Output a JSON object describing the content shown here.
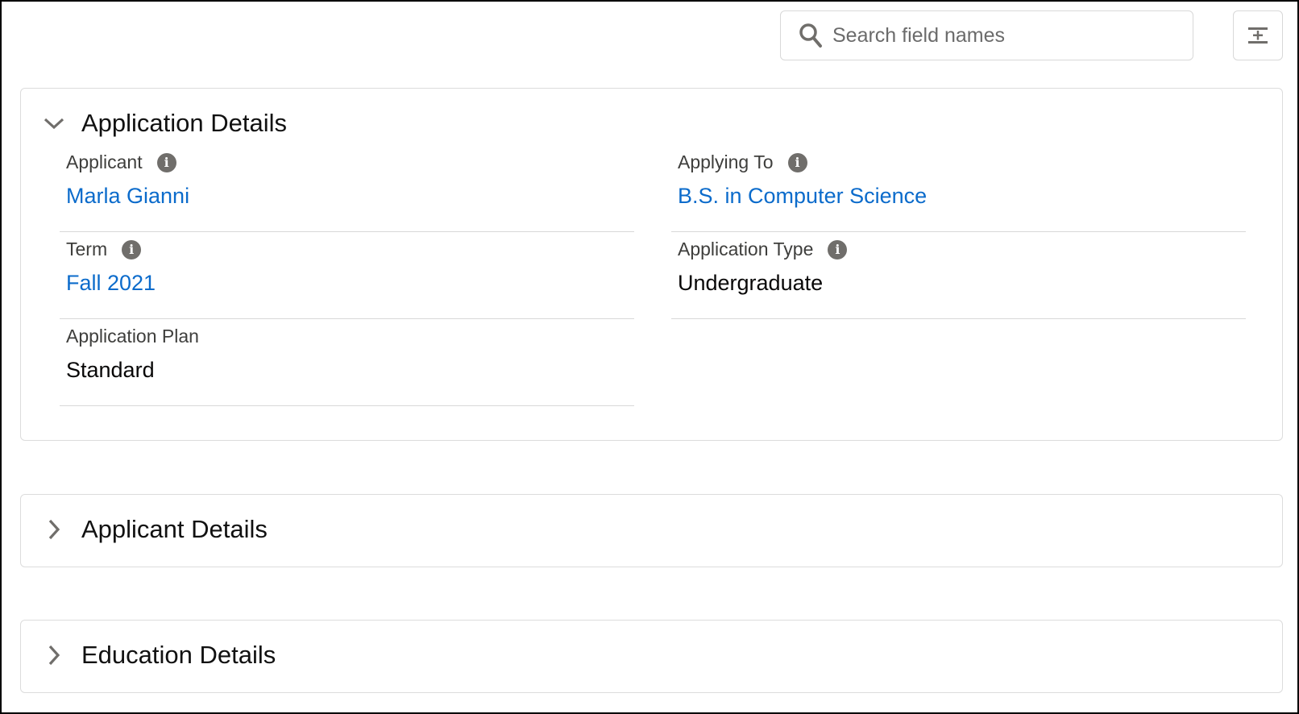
{
  "search": {
    "placeholder": "Search field names"
  },
  "sections": [
    {
      "title": "Application Details",
      "expanded": true,
      "fields": [
        {
          "label": "Applicant",
          "value": "Marla Gianni",
          "link": true,
          "info": true
        },
        {
          "label": "Applying To",
          "value": "B.S. in Computer Science",
          "link": true,
          "info": true
        },
        {
          "label": "Term",
          "value": "Fall 2021",
          "link": true,
          "info": true
        },
        {
          "label": "Application Type",
          "value": "Undergraduate",
          "link": false,
          "info": true
        },
        {
          "label": "Application Plan",
          "value": "Standard",
          "link": false,
          "info": false
        }
      ]
    },
    {
      "title": "Applicant Details",
      "expanded": false
    },
    {
      "title": "Education Details",
      "expanded": false
    }
  ],
  "colors": {
    "link": "#0b6bcb",
    "icon": "#706e6b",
    "border": "#dcdcdc"
  }
}
